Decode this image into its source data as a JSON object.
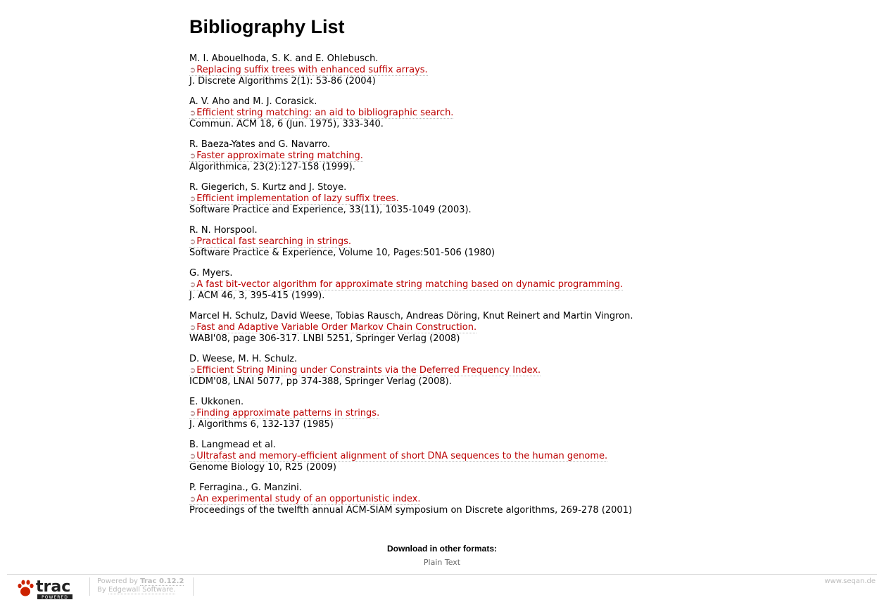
{
  "page": {
    "title": "Bibliography List"
  },
  "entries": [
    {
      "authors": "M. I. Abouelhoda, S. K. and E. Ohlebusch.",
      "title": "Replacing suffix trees with enhanced suffix arrays.",
      "venue": "J. Discrete Algorithms 2(1): 53-86 (2004)"
    },
    {
      "authors": "A. V. Aho and M. J. Corasick.",
      "title": "Efficient string matching: an aid to bibliographic search.",
      "venue": "Commun. ACM 18, 6 (Jun. 1975), 333-340."
    },
    {
      "authors": "R. Baeza-Yates and G. Navarro.",
      "title": "Faster approximate string matching.",
      "venue": "Algorithmica, 23(2):127-158 (1999)."
    },
    {
      "authors": "R. Giegerich, S. Kurtz and J. Stoye.",
      "title": "Efficient implementation of lazy suffix trees.",
      "venue": "Software Practice and Experience, 33(11), 1035-1049 (2003)."
    },
    {
      "authors": "R. N. Horspool.",
      "title": "Practical fast searching in strings.",
      "venue": "Software Practice & Experience, Volume 10, Pages:501-506 (1980)"
    },
    {
      "authors": "G. Myers.",
      "title": "A fast bit-vector algorithm for approximate string matching based on dynamic programming.",
      "venue": "J. ACM 46, 3, 395-415 (1999)."
    },
    {
      "authors": "Marcel H. Schulz, David Weese, Tobias Rausch, Andreas Döring, Knut Reinert and Martin Vingron.",
      "title": "Fast and Adaptive Variable Order Markov Chain Construction.",
      "venue": "WABI'08, page 306-317. LNBI 5251, Springer Verlag (2008)"
    },
    {
      "authors": "D. Weese, M. H. Schulz.",
      "title": "Efficient String Mining under Constraints via the Deferred Frequency Index.",
      "venue": "ICDM'08, LNAI 5077, pp 374-388, Springer Verlag (2008)."
    },
    {
      "authors": "E. Ukkonen.",
      "title": "Finding approximate patterns in strings.",
      "venue": "J. Algorithms 6, 132-137 (1985)"
    },
    {
      "authors": "B. Langmead et al.",
      "title": "Ultrafast and memory-efficient alignment of short DNA sequences to the human genome.",
      "venue": "Genome Biology 10, R25 (2009)"
    },
    {
      "authors": "P. Ferragina., G. Manzini.",
      "title": "An experimental study of an opportunistic index.",
      "venue": "Proceedings of the twelfth annual ACM-SIAM symposium on Discrete algorithms, 269-278 (2001)"
    }
  ],
  "download": {
    "heading": "Download in other formats:",
    "plain_text": "Plain Text"
  },
  "footer": {
    "logo_text": "trac",
    "logo_subtext": "POWERED",
    "powered_by": "Powered by",
    "trac_version": "Trac 0.12.2",
    "by": "By",
    "edgewall": "Edgewall Software.",
    "site": "www.seqan.de"
  },
  "icons": {
    "external_link": "external-link-icon",
    "paw": "paw-icon"
  },
  "colors": {
    "link": "#bb0000",
    "footer_text": "#bbbbbb"
  }
}
